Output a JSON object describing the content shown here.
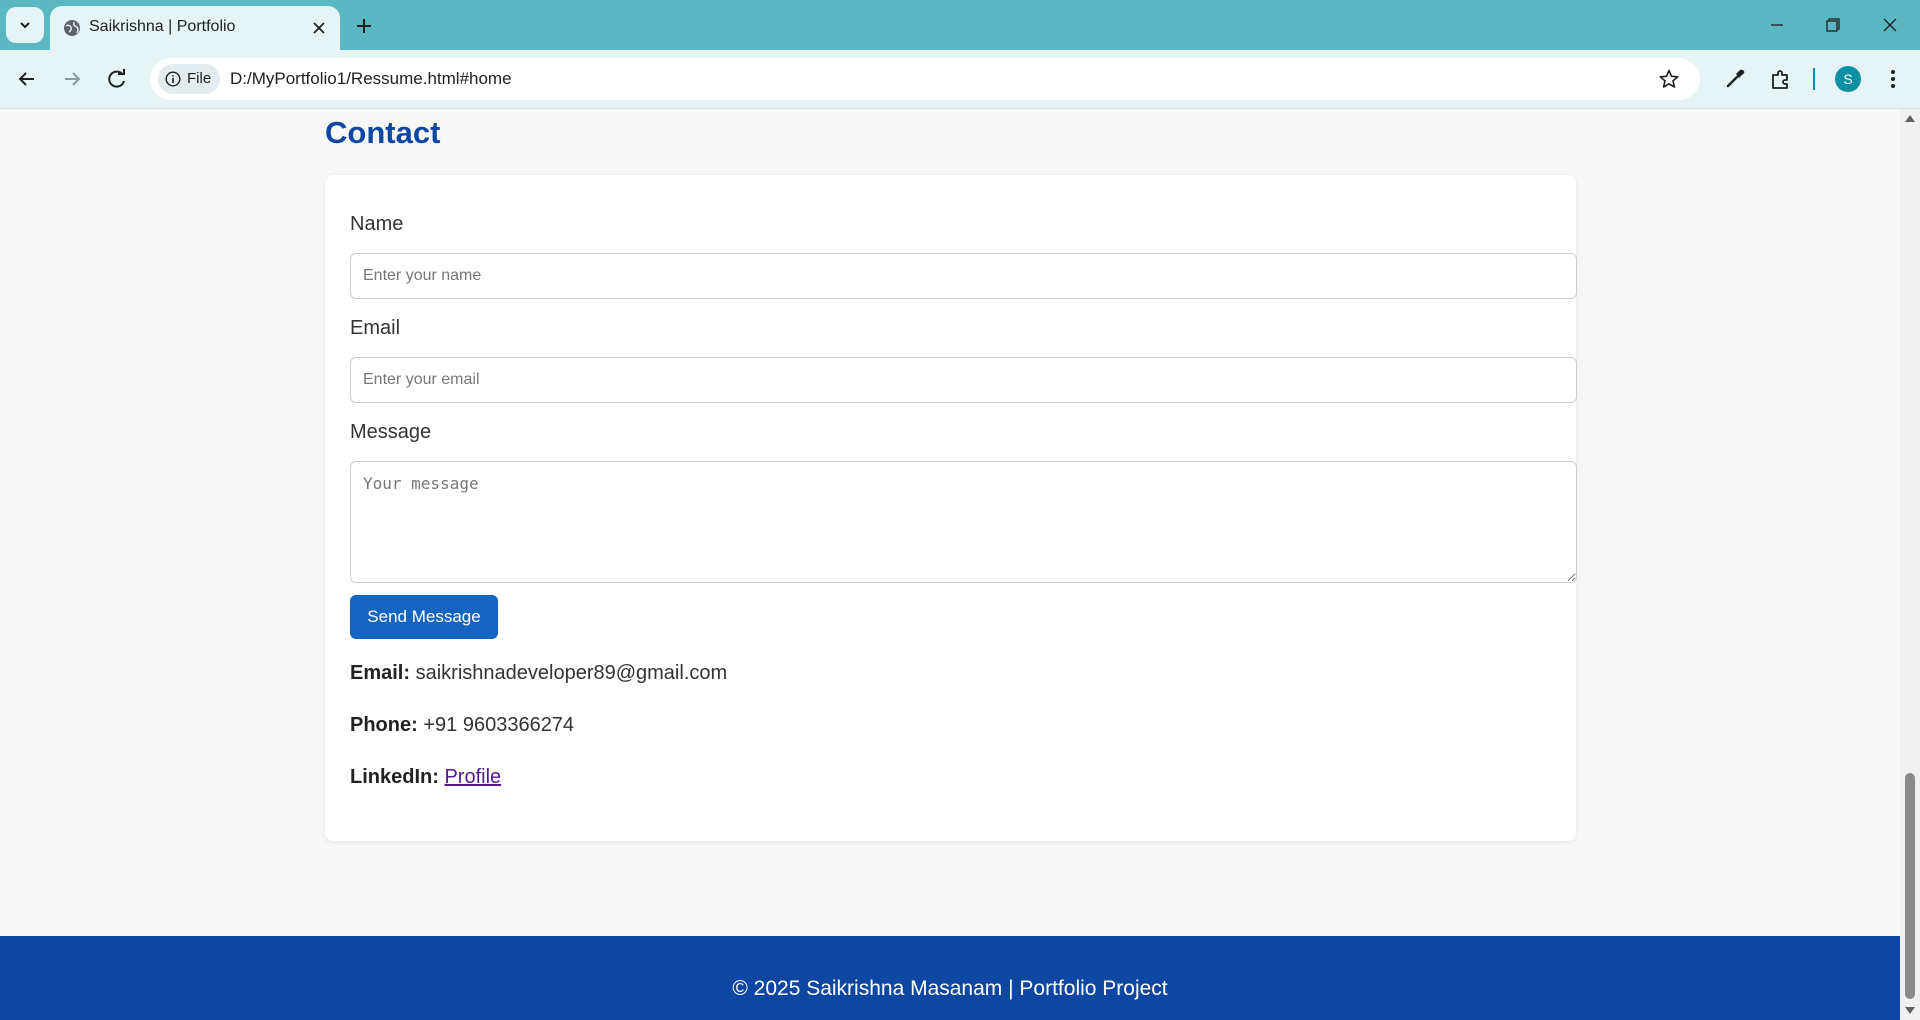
{
  "browser": {
    "tab_title": "Saikrishna | Portfolio",
    "file_chip": "File",
    "url": "D:/MyPortfolio1/Ressume.html#home",
    "profile_initial": "S"
  },
  "contact": {
    "heading": "Contact",
    "name_label": "Name",
    "name_placeholder": "Enter your name",
    "email_label": "Email",
    "email_placeholder": "Enter your email",
    "message_label": "Message",
    "message_placeholder": "Your message",
    "send_button": "Send Message",
    "email_key": "Email:",
    "email_value": "saikrishnadeveloper89@gmail.com",
    "phone_key": "Phone:",
    "phone_value": "+91 9603366274",
    "linkedin_key": "LinkedIn:",
    "linkedin_link": "Profile"
  },
  "footer": {
    "text": "© 2025 Saikrishna Masanam | Portfolio Project"
  },
  "colors": {
    "tabbar": "#5bb8c3",
    "heading": "#0d47a1",
    "button": "#1565c0",
    "footer": "#0d47a1"
  }
}
